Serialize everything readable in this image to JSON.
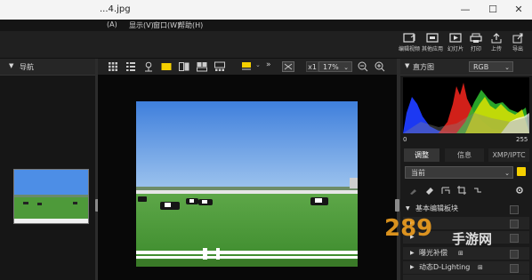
{
  "window": {
    "title": "...4.jpg",
    "controls": {
      "minimize": "—",
      "maximize": "☐",
      "close": "✕"
    }
  },
  "menubar": {
    "items": [
      "(A)",
      "显示(V)",
      "窗口(W)",
      "帮助(H)"
    ]
  },
  "toolbar": {
    "buttons": [
      {
        "label": "编辑视频",
        "icon": "edit-video-icon"
      },
      {
        "label": "其他应用",
        "icon": "other-apps-icon"
      },
      {
        "label": "幻灯片",
        "icon": "slideshow-icon"
      },
      {
        "label": "打印",
        "icon": "print-icon"
      },
      {
        "label": "上传",
        "icon": "upload-icon"
      },
      {
        "label": "导出",
        "icon": "export-icon"
      }
    ]
  },
  "navigator": {
    "title": "导航"
  },
  "viewer": {
    "zoom_multiplier": "x1",
    "zoom_level": "17%"
  },
  "histogram": {
    "title": "直方图",
    "channel": "RGB",
    "min_label": "0",
    "max_label": "255"
  },
  "adjust": {
    "tabs": [
      "调整",
      "信息",
      "XMP/IPTC"
    ],
    "active_tab": "调整",
    "preset": "当前",
    "section_title": "基本编辑板块",
    "rows": [
      {
        "label": "曝光补偿",
        "badge": "⊞"
      },
      {
        "label": "动态D-Lighting",
        "badge": "⊞"
      }
    ]
  },
  "watermark": {
    "number": "289",
    "text": "手游网"
  },
  "colors": {
    "accent_yellow": "#f5d000",
    "panel_bg": "#1a1a1a",
    "viewer_bg": "#080808",
    "titlebar_bg": "#f4f4f4"
  }
}
